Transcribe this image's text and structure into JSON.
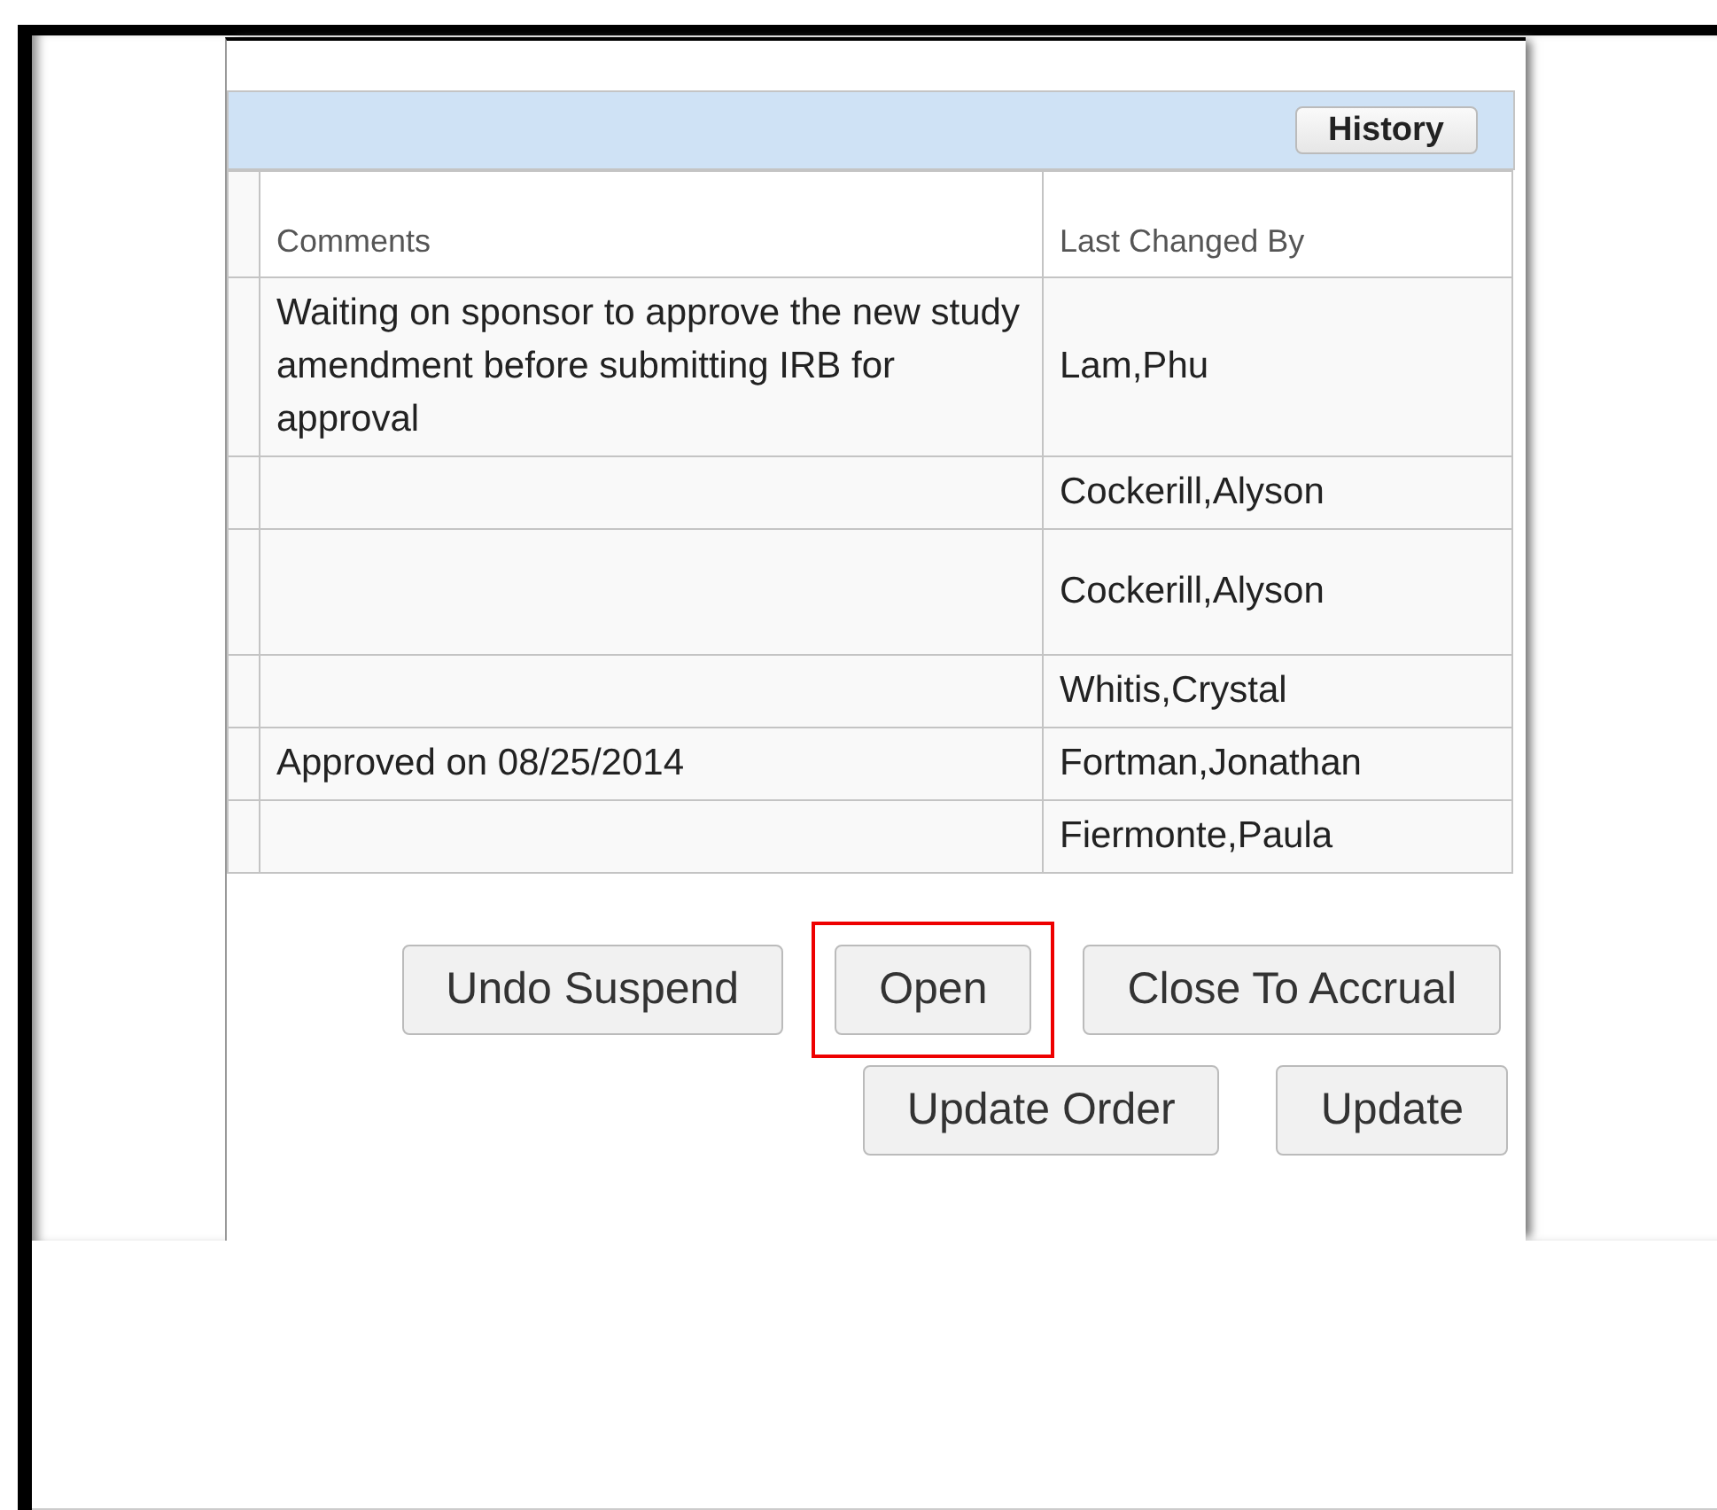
{
  "header_bar": {
    "history_button": "History"
  },
  "table": {
    "columns": [
      "Comments",
      "Last Changed By"
    ],
    "rows": [
      {
        "comments": "Waiting on sponsor to approve the new study amendment before submitting IRB for approval",
        "last_changed_by": "Lam,Phu"
      },
      {
        "comments": "",
        "last_changed_by": "Cockerill,Alyson"
      },
      {
        "comments": "",
        "last_changed_by": "Cockerill,Alyson"
      },
      {
        "comments": "",
        "last_changed_by": "Whitis,Crystal"
      },
      {
        "comments": "Approved on 08/25/2014",
        "last_changed_by": "Fortman,Jonathan"
      },
      {
        "comments": "",
        "last_changed_by": "Fiermonte,Paula"
      }
    ]
  },
  "button_rows": [
    [
      {
        "label": "Undo Suspend",
        "highlighted": false
      },
      {
        "label": "Open",
        "highlighted": true
      },
      {
        "label": "Close To Accrual",
        "highlighted": false
      }
    ],
    [
      {
        "label": "Update Order",
        "highlighted": false
      },
      {
        "label": "Update",
        "highlighted": false
      }
    ]
  ]
}
